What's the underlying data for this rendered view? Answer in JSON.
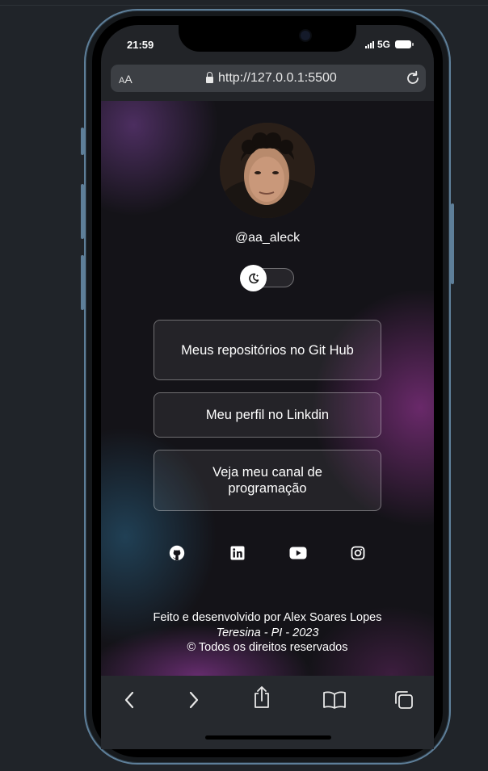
{
  "status_bar": {
    "time": "21:59",
    "network": "5G"
  },
  "browser": {
    "text_size_label_small": "A",
    "text_size_label_large": "A",
    "url": "http://127.0.0.1:5500"
  },
  "profile": {
    "username": "@aa_aleck"
  },
  "theme_toggle": {
    "state": "dark"
  },
  "links": [
    {
      "label": "Meus repositórios no Git Hub"
    },
    {
      "label": "Meu perfil no Linkdin"
    },
    {
      "label": "Veja meu canal de programação"
    }
  ],
  "social_icons": [
    "github-icon",
    "linkedin-icon",
    "youtube-icon",
    "instagram-icon"
  ],
  "footer": {
    "line1": "Feito e desenvolvido por Alex Soares Lopes",
    "line2": "Teresina - PI - 2023",
    "line3": "© Todos os direitos reservados"
  },
  "colors": {
    "background": "#202429",
    "frame": "#5e7f99",
    "content_bg": "#141318",
    "accent_purple": "#782d78",
    "text": "#ffffff"
  }
}
